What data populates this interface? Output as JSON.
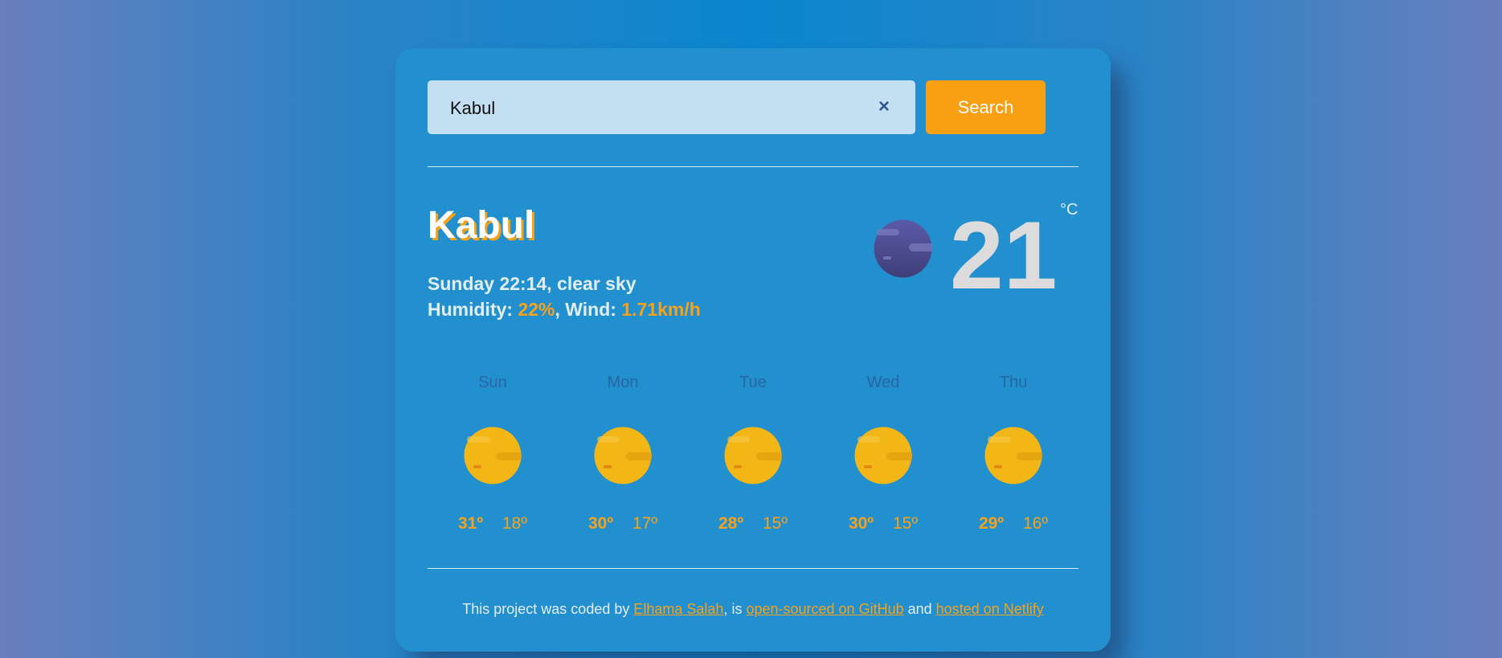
{
  "search": {
    "value": "Kabul",
    "button_label": "Search",
    "clear_icon": "×"
  },
  "current": {
    "city": "Kabul",
    "day_time_desc": "Sunday 22:14, clear sky",
    "humidity_label": "Humidity: ",
    "humidity_value": "22%",
    "wind_label": ", Wind: ",
    "wind_value": "1.71km/h",
    "temperature": "21",
    "unit": "°C",
    "icon": "moon-clear-night-icon"
  },
  "forecast": [
    {
      "day": "Sun",
      "max": "31º",
      "min": "18º",
      "icon": "sun-icon"
    },
    {
      "day": "Mon",
      "max": "30º",
      "min": "17º",
      "icon": "sun-icon"
    },
    {
      "day": "Tue",
      "max": "28º",
      "min": "15º",
      "icon": "sun-icon"
    },
    {
      "day": "Wed",
      "max": "30º",
      "min": "15º",
      "icon": "sun-icon"
    },
    {
      "day": "Thu",
      "max": "29º",
      "min": "16º",
      "icon": "sun-icon"
    }
  ],
  "footer": {
    "prefix": "This project was coded by ",
    "author": "Elhama Salah",
    "mid1": ", is ",
    "github": "open-sourced on GitHub",
    "mid2": " and ",
    "netlify": "hosted on Netlify"
  },
  "colors": {
    "accent": "#f99f12",
    "card": "#228fcf",
    "input_bg": "#c4dff2"
  }
}
